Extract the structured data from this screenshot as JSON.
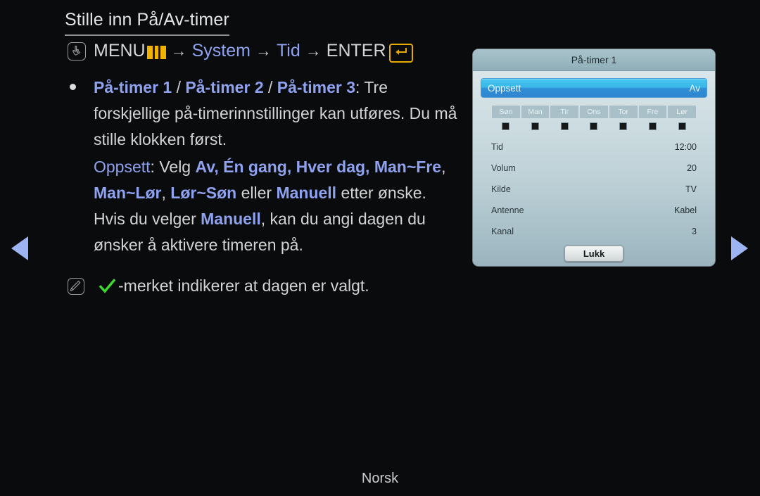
{
  "page": {
    "title": "Stille inn På/Av-timer",
    "language_footer": "Norsk"
  },
  "menu_path": {
    "hand_icon": "hand-pointer-icon",
    "menu_label": "MENU",
    "menu_bars_icon": "menu-bars-icon",
    "arrow1": "→",
    "system_label": "System",
    "arrow2": "→",
    "tid_label": "Tid",
    "arrow3": "→",
    "enter_label": "ENTER",
    "enter_icon": "return-key-icon"
  },
  "bullets": [
    {
      "timer1": "På-timer 1",
      "slash1": " / ",
      "timer2": "På-timer 2",
      "slash2": " / ",
      "timer3": "På-timer 3",
      "rest": ": Tre forskjellige på-timerinnstillinger kan utføres. Du må stille klokken først."
    }
  ],
  "oppsett_paragraph": {
    "label": "Oppsett",
    "colon_velg": ": Velg ",
    "opt_av": "Av,",
    "opt_en_gang": " Én gang,",
    "opt_hver_dag": " Hver dag,",
    "opt_man_fre": "Man~Fre",
    "comma1": ", ",
    "opt_man_lor": "Man~Lør",
    "comma2": ", ",
    "opt_lor_son": "Lør~Søn",
    "eller": " eller ",
    "opt_manuell": "Manuell",
    "tail_pre": "etter ønske. Hvis du velger ",
    "tail_manuell": "Manuell",
    "tail_post": ", kan du angi dagen du ønsker å aktivere timeren på."
  },
  "note": {
    "icon": "note-pencil-icon",
    "check_icon": "green-check-icon",
    "text": "-merket indikerer at dagen er valgt."
  },
  "navigation": {
    "prev_icon": "triangle-left-icon",
    "next_icon": "triangle-right-icon"
  },
  "osd": {
    "title": "På-timer 1",
    "highlight_row": {
      "label": "Oppsett",
      "value": "Av"
    },
    "days": [
      {
        "label": "Søn",
        "checked": true
      },
      {
        "label": "Man",
        "checked": true
      },
      {
        "label": "Tir",
        "checked": true
      },
      {
        "label": "Ons",
        "checked": true
      },
      {
        "label": "Tor",
        "checked": true
      },
      {
        "label": "Fre",
        "checked": true
      },
      {
        "label": "Lør",
        "checked": true
      }
    ],
    "rows": [
      {
        "label": "Tid",
        "value": "12:00"
      },
      {
        "label": "Volum",
        "value": "20"
      },
      {
        "label": "Kilde",
        "value": "TV"
      },
      {
        "label": "Antenne",
        "value": "Kabel"
      },
      {
        "label": "Kanal",
        "value": "3"
      }
    ],
    "close_button": "Lukk"
  },
  "colors": {
    "background": "#0a0b0d",
    "body_text": "#d4d4d4",
    "accent_blue": "#8fa2f0",
    "accent_yellow": "#f0b400",
    "nav_arrow": "#9db4f2",
    "osd_highlight": "#3ab8e8",
    "check_green": "#3ddb2e"
  }
}
